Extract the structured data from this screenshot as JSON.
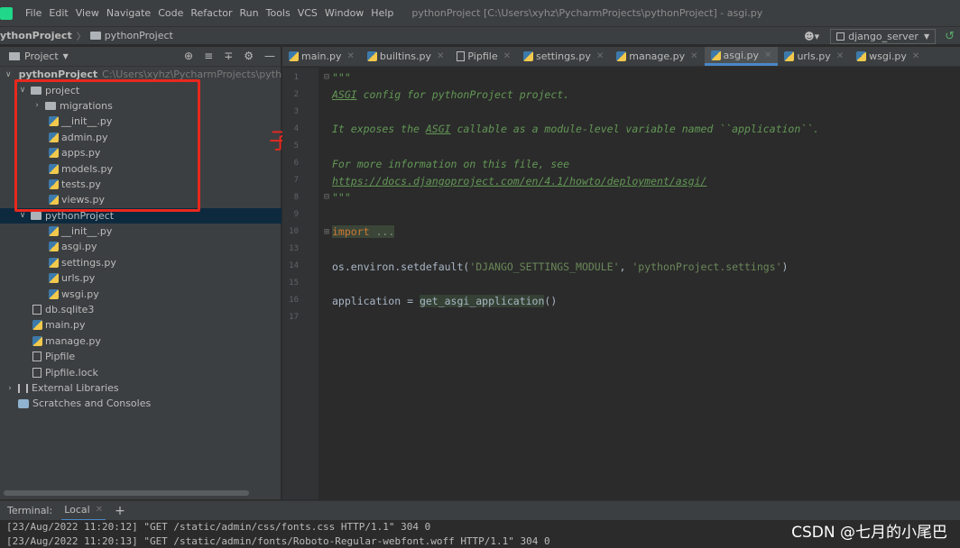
{
  "menu": {
    "items": [
      "File",
      "Edit",
      "View",
      "Navigate",
      "Code",
      "Refactor",
      "Run",
      "Tools",
      "VCS",
      "Window",
      "Help"
    ],
    "title": "pythonProject [C:\\Users\\xyhz\\PycharmProjects\\pythonProject] - asgi.py"
  },
  "navbar": {
    "crumb_root": "ythonProject",
    "crumb_folder": "pythonProject",
    "user_icon": "user-icon",
    "run_config": "django_server",
    "run_icon": "run-icon"
  },
  "project_panel": {
    "title": "Project",
    "tree": [
      {
        "label": "pythonProject",
        "path": "C:\\Users\\xyhz\\PycharmProjects\\pythor",
        "type": "folder",
        "depth": 0,
        "expanded": true,
        "bold": true
      },
      {
        "label": "project",
        "type": "folder",
        "depth": 1,
        "expanded": true
      },
      {
        "label": "migrations",
        "type": "folder",
        "depth": 2,
        "expanded": false
      },
      {
        "label": "__init__.py",
        "type": "py",
        "depth": 3
      },
      {
        "label": "admin.py",
        "type": "py",
        "depth": 3
      },
      {
        "label": "apps.py",
        "type": "py",
        "depth": 3
      },
      {
        "label": "models.py",
        "type": "py",
        "depth": 3
      },
      {
        "label": "tests.py",
        "type": "py",
        "depth": 3
      },
      {
        "label": "views.py",
        "type": "py",
        "depth": 3
      },
      {
        "label": "pythonProject",
        "type": "folder",
        "depth": 1,
        "expanded": true,
        "selected": true
      },
      {
        "label": "__init__.py",
        "type": "py",
        "depth": 3
      },
      {
        "label": "asgi.py",
        "type": "py",
        "depth": 3
      },
      {
        "label": "settings.py",
        "type": "py",
        "depth": 3
      },
      {
        "label": "urls.py",
        "type": "py",
        "depth": 3
      },
      {
        "label": "wsgi.py",
        "type": "py",
        "depth": 3
      },
      {
        "label": "db.sqlite3",
        "type": "file",
        "depth": 2
      },
      {
        "label": "main.py",
        "type": "py",
        "depth": 2
      },
      {
        "label": "manage.py",
        "type": "py",
        "depth": 2
      },
      {
        "label": "Pipfile",
        "type": "file",
        "depth": 2
      },
      {
        "label": "Pipfile.lock",
        "type": "file",
        "depth": 2
      },
      {
        "label": "External Libraries",
        "type": "lib",
        "depth": 0,
        "expanded": false
      },
      {
        "label": "Scratches and Consoles",
        "type": "scratch",
        "depth": 1
      }
    ]
  },
  "annotation": {
    "text": "子应用",
    "color": "#e8281e"
  },
  "tabs": [
    {
      "label": "main.py",
      "icon": "py",
      "active": false
    },
    {
      "label": "builtins.py",
      "icon": "py",
      "active": false
    },
    {
      "label": "Pipfile",
      "icon": "file",
      "active": false
    },
    {
      "label": "settings.py",
      "icon": "py",
      "active": false
    },
    {
      "label": "manage.py",
      "icon": "py",
      "active": false
    },
    {
      "label": "asgi.py",
      "icon": "py",
      "active": true
    },
    {
      "label": "urls.py",
      "icon": "py",
      "active": false
    },
    {
      "label": "wsgi.py",
      "icon": "py",
      "active": false
    }
  ],
  "editor": {
    "line_numbers": [
      "1",
      "2",
      "3",
      "4",
      "5",
      "6",
      "7",
      "8",
      "9",
      "10",
      "13",
      "14",
      "15",
      "16",
      "17"
    ],
    "code": {
      "l1": "\"\"\"",
      "l2_a": "ASGI",
      "l2_b": " config for pythonProject project.",
      "l4_a": "It exposes the ",
      "l4_b": "ASGI",
      "l4_c": " callable as a module-level variable named ``application``.",
      "l6": "For more information on this file, see",
      "l7": "https://docs.djangoproject.com/en/4.1/howto/deployment/asgi/",
      "l8": "\"\"\"",
      "l10_kw": "import",
      "l10_dots": " ...",
      "l14_a": "os.environ.setdefault(",
      "l14_s1": "'DJANGO_SETTINGS_MODULE'",
      "l14_b": ", ",
      "l14_s2": "'pythonProject.settings'",
      "l14_c": ")",
      "l16_a": "application = ",
      "l16_fn": "get_asgi_application",
      "l16_b": "()"
    }
  },
  "terminal": {
    "label": "Terminal:",
    "tab": "Local",
    "lines": [
      "[23/Aug/2022 11:20:12] \"GET /static/admin/css/fonts.css HTTP/1.1\" 304 0",
      "[23/Aug/2022 11:20:13] \"GET /static/admin/fonts/Roboto-Regular-webfont.woff HTTP/1.1\" 304 0"
    ]
  },
  "watermark": "CSDN @七月的小尾巴",
  "colors": {
    "accent": "#4a88c7",
    "annotation": "#e8281e",
    "docstring": "#629755",
    "string": "#6a8759",
    "keyword": "#cc7832"
  }
}
